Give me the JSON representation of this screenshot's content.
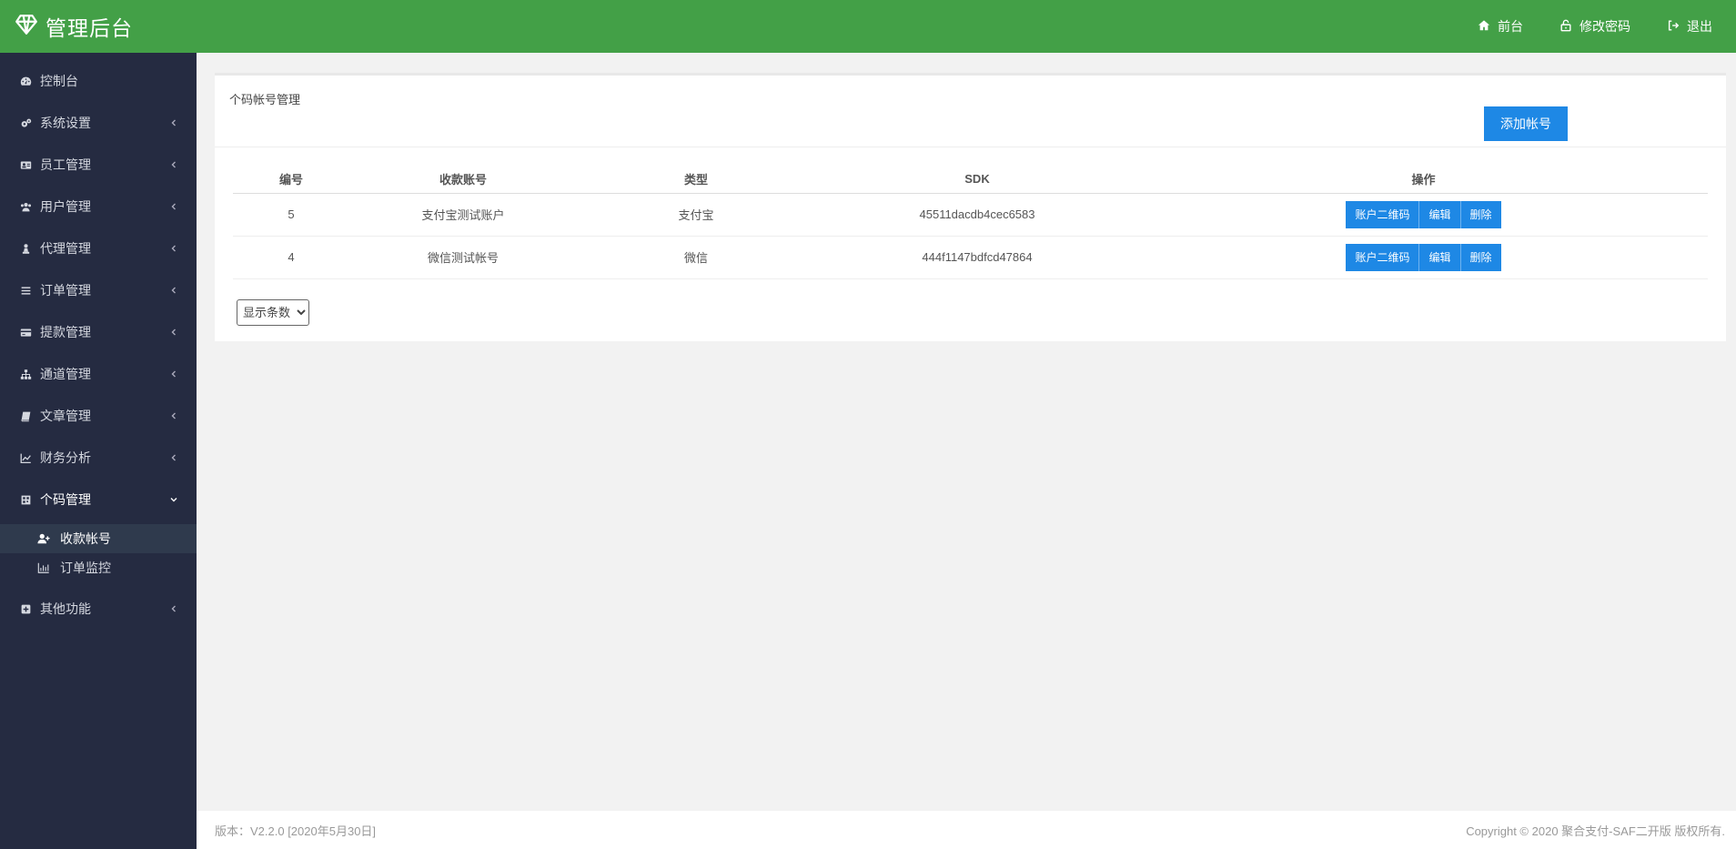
{
  "header": {
    "title": "管理后台",
    "links": [
      {
        "label": "前台",
        "icon": "home-icon"
      },
      {
        "label": "修改密码",
        "icon": "unlock-icon"
      },
      {
        "label": "退出",
        "icon": "sign-out-icon"
      }
    ]
  },
  "sidebar": {
    "items": [
      {
        "label": "控制台",
        "icon": "dashboard-icon"
      },
      {
        "label": "系统设置",
        "icon": "cogs-icon"
      },
      {
        "label": "员工管理",
        "icon": "id-card-icon"
      },
      {
        "label": "用户管理",
        "icon": "users-icon"
      },
      {
        "label": "代理管理",
        "icon": "chess-pawn-icon"
      },
      {
        "label": "订单管理",
        "icon": "list-icon"
      },
      {
        "label": "提款管理",
        "icon": "credit-card-icon"
      },
      {
        "label": "通道管理",
        "icon": "sitemap-icon"
      },
      {
        "label": "文章管理",
        "icon": "book-icon"
      },
      {
        "label": "财务分析",
        "icon": "line-chart-icon"
      },
      {
        "label": "个码管理",
        "icon": "qrcode-icon"
      },
      {
        "label": "其他功能",
        "icon": "plus-square-icon"
      }
    ],
    "sub_items": [
      {
        "label": "收款帐号",
        "icon": "user-plus-icon"
      },
      {
        "label": "订单监控",
        "icon": "bar-chart-icon"
      }
    ]
  },
  "panel": {
    "title": "个码帐号管理",
    "add_button": "添加帐号"
  },
  "table": {
    "headers": [
      "编号",
      "收款账号",
      "类型",
      "SDK",
      "操作"
    ],
    "rows": [
      {
        "id": "5",
        "account": "支付宝测试账户",
        "type": "支付宝",
        "sdk": "45511dacdb4cec6583"
      },
      {
        "id": "4",
        "account": "微信测试帐号",
        "type": "微信",
        "sdk": "444f1147bdfcd47864"
      }
    ],
    "actions": {
      "qr": "账户二维码",
      "edit": "编辑",
      "delete": "删除"
    }
  },
  "page_size": {
    "selected": "显示条数"
  },
  "footer": {
    "version": "版本：V2.2.0 [2020年5月30日]",
    "copyright": "Copyright © 2020 聚合支付-SAF二开版 版权所有."
  },
  "colors": {
    "header": "#43a047",
    "sidebar": "#252b41",
    "primary_button": "#1e88e5"
  }
}
